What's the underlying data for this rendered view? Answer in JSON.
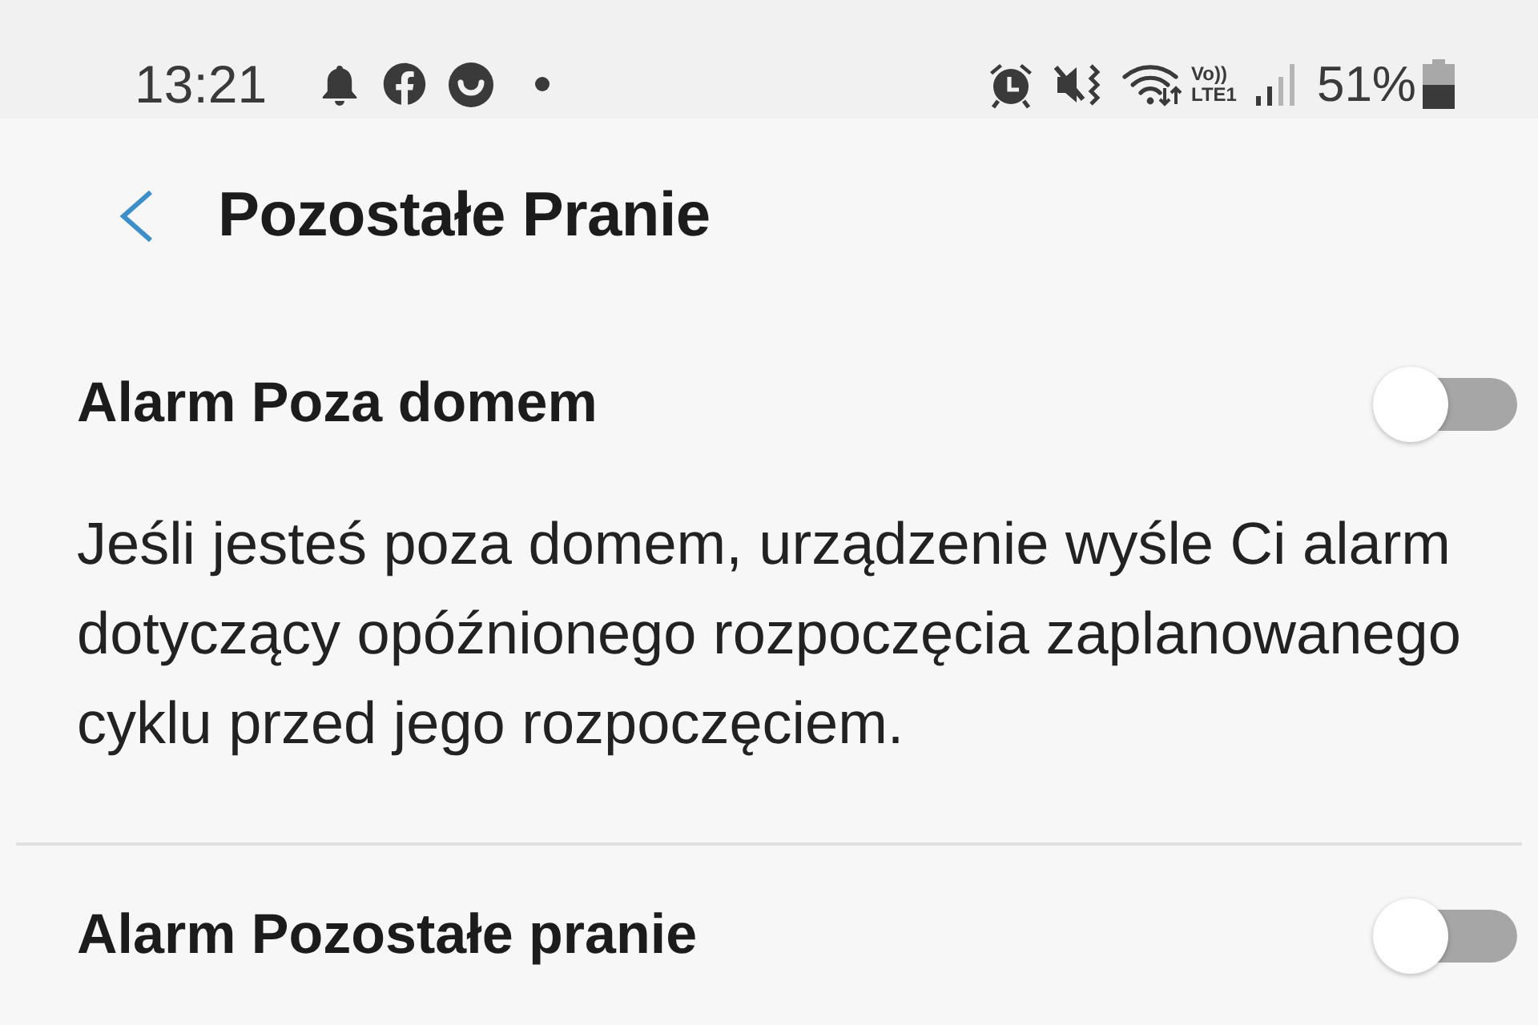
{
  "status_bar": {
    "time": "13:21",
    "network_labels": [
      "Vo))",
      "LTE1"
    ],
    "battery_percent": "51%"
  },
  "header": {
    "title": "Pozostałe Pranie"
  },
  "settings": [
    {
      "title": "Alarm Poza domem",
      "on": false,
      "description": "Jeśli jesteś poza domem, urządzenie wyśle Ci alarm dotyczący opóźnionego rozpoczęcia zaplanowanego cyklu przed jego rozpoczęciem."
    },
    {
      "title": "Alarm Pozostałe pranie",
      "on": false
    }
  ]
}
